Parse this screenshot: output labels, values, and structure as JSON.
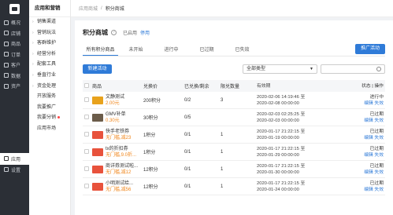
{
  "nav": {
    "items": [
      {
        "label": "概况",
        "icon": "home-icon"
      },
      {
        "label": "店铺",
        "icon": "store-icon"
      },
      {
        "label": "商品",
        "icon": "goods-icon"
      },
      {
        "label": "订单",
        "icon": "order-icon"
      },
      {
        "label": "客户",
        "icon": "customer-icon"
      },
      {
        "label": "数据",
        "icon": "data-icon"
      },
      {
        "label": "资产",
        "icon": "asset-icon"
      },
      {
        "label": "应用",
        "icon": "apps-icon"
      },
      {
        "label": "设置",
        "icon": "settings-icon"
      }
    ]
  },
  "subnav": {
    "title": "应用和营销",
    "items": [
      "销售渠道",
      "营销玩法",
      "客群维护",
      "经营分析",
      "配套工具",
      "垂直行业",
      "资金处理",
      "开放服务",
      "我要推广",
      "我要分销",
      "应用市场"
    ]
  },
  "breadcrumb": {
    "parent": "应用商城",
    "sep": "/",
    "current": "积分商城"
  },
  "page": {
    "title": "积分商城",
    "status": "已启用",
    "disable_link": "停用",
    "promo_button": "推广活动",
    "tabs": [
      "所有积分商品",
      "未开始",
      "进行中",
      "已过期",
      "已失效"
    ],
    "new_button": "新建活动",
    "select_value": "全部类型"
  },
  "table": {
    "headers": [
      "商品",
      "兑换价",
      "已兑换/剩余",
      "限兑数量",
      "有效期",
      "状态 | 操作"
    ],
    "rows": [
      {
        "name": "文静测试",
        "sub": "2.00元",
        "cost": "200积分",
        "count": "0/2",
        "limit": "3",
        "valid_from": "2020-02-06 14:19:46 至",
        "valid_to": "2020-02-08 00:00:00",
        "status": "进行中",
        "ops": "编辑  失效",
        "thumb": "#e8a21c"
      },
      {
        "name": "GMV补单",
        "sub": "0.30元",
        "cost": "30积分",
        "count": "0/5",
        "limit": "",
        "valid_from": "2020-02-03 02:25:25 至",
        "valid_to": "2020-02-03 00:00:00",
        "status": "已过期",
        "ops": "编辑  失效",
        "thumb": "#6b5c4a"
      },
      {
        "name": "快手老铁券",
        "sub": "无门槛,减23",
        "cost": "1积分",
        "count": "0/1",
        "limit": "1",
        "valid_from": "2020-01-17 21:22:15 至",
        "valid_to": "2020-01-19 00:00:00",
        "status": "已过期",
        "ops": "编辑  失效",
        "thumb": "#e8523c"
      },
      {
        "name": "tx的折扣券",
        "sub": "无门槛,9.0折...",
        "cost": "1积分",
        "count": "0/1",
        "limit": "1",
        "valid_from": "2020-01-17 21:22:15 至",
        "valid_to": "2020-01-29 00:00:00",
        "status": "已过期",
        "ops": "编辑  失效",
        "thumb": "#e8523c"
      },
      {
        "name": "商详券测试啦...",
        "sub": "无门槛,减12",
        "cost": "12积分",
        "count": "0/1",
        "limit": "1",
        "valid_from": "2020-01-17 21:22:15 至",
        "valid_to": "2020-01-30 00:00:00",
        "status": "已过期",
        "ops": "编辑  失效",
        "thumb": "#e8523c"
      },
      {
        "name": "小明测试给...",
        "sub": "无门槛,减56",
        "cost": "12积分",
        "count": "0/1",
        "limit": "1",
        "valid_from": "2020-01-17 21:22:15 至",
        "valid_to": "2020-01-24 00:00:00",
        "status": "已过期",
        "ops": "编辑  失效",
        "thumb": "#e8523c"
      }
    ]
  }
}
